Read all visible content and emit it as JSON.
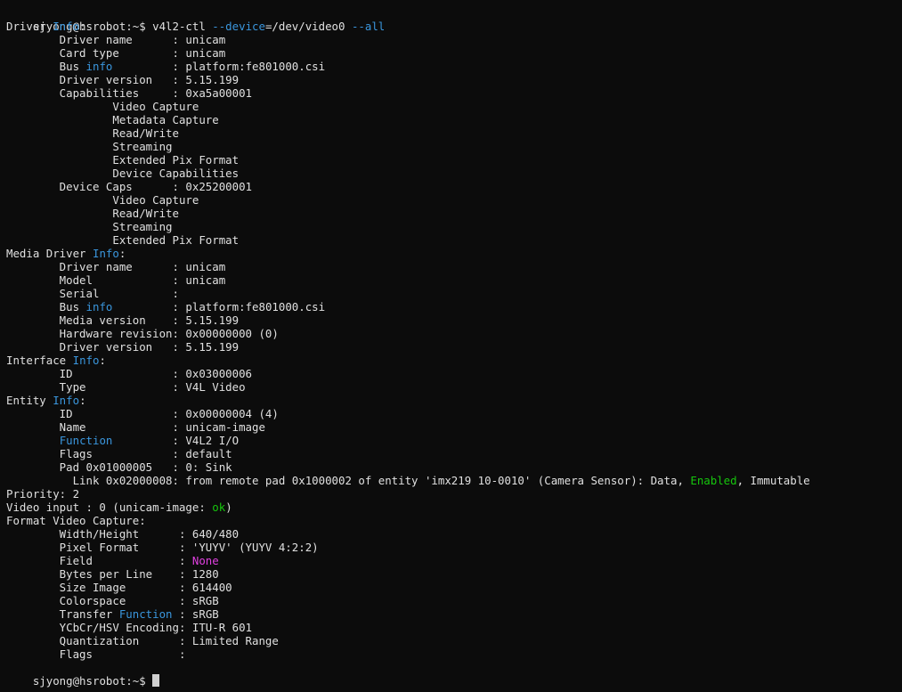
{
  "terminal": {
    "prompt": "sjyong@hsrobot:~$ ",
    "command_parts": [
      {
        "t": "v4l2-ctl "
      },
      {
        "t": "--device",
        "c": "cyan"
      },
      {
        "t": "=/dev/video0 "
      },
      {
        "t": "--all",
        "c": "cyan"
      }
    ],
    "lines": [
      [
        {
          "t": "Driver "
        },
        {
          "t": "Info",
          "c": "cyan"
        },
        {
          "t": ":"
        }
      ],
      [
        {
          "t": "        Driver name      : unicam"
        }
      ],
      [
        {
          "t": "        Card type        : unicam"
        }
      ],
      [
        {
          "t": "        Bus "
        },
        {
          "t": "info",
          "c": "cyan"
        },
        {
          "t": "         : platform:fe801000.csi"
        }
      ],
      [
        {
          "t": "        Driver version   : 5.15.199"
        }
      ],
      [
        {
          "t": "        Capabilities     : 0xa5a00001"
        }
      ],
      [
        {
          "t": "                Video Capture"
        }
      ],
      [
        {
          "t": "                Metadata Capture"
        }
      ],
      [
        {
          "t": "                Read/Write"
        }
      ],
      [
        {
          "t": "                Streaming"
        }
      ],
      [
        {
          "t": "                Extended Pix Format"
        }
      ],
      [
        {
          "t": "                Device Capabilities"
        }
      ],
      [
        {
          "t": "        Device Caps      : 0x25200001"
        }
      ],
      [
        {
          "t": "                Video Capture"
        }
      ],
      [
        {
          "t": "                Read/Write"
        }
      ],
      [
        {
          "t": "                Streaming"
        }
      ],
      [
        {
          "t": "                Extended Pix Format"
        }
      ],
      [
        {
          "t": "Media Driver "
        },
        {
          "t": "Info",
          "c": "cyan"
        },
        {
          "t": ":"
        }
      ],
      [
        {
          "t": "        Driver name      : unicam"
        }
      ],
      [
        {
          "t": "        Model            : unicam"
        }
      ],
      [
        {
          "t": "        Serial           :"
        }
      ],
      [
        {
          "t": "        Bus "
        },
        {
          "t": "info",
          "c": "cyan"
        },
        {
          "t": "         : platform:fe801000.csi"
        }
      ],
      [
        {
          "t": "        Media version    : 5.15.199"
        }
      ],
      [
        {
          "t": "        Hardware revision: 0x00000000 (0)"
        }
      ],
      [
        {
          "t": "        Driver version   : 5.15.199"
        }
      ],
      [
        {
          "t": "Interface "
        },
        {
          "t": "Info",
          "c": "cyan"
        },
        {
          "t": ":"
        }
      ],
      [
        {
          "t": "        ID               : 0x03000006"
        }
      ],
      [
        {
          "t": "        Type             : V4L Video"
        }
      ],
      [
        {
          "t": "Entity "
        },
        {
          "t": "Info",
          "c": "cyan"
        },
        {
          "t": ":"
        }
      ],
      [
        {
          "t": "        ID               : 0x00000004 (4)"
        }
      ],
      [
        {
          "t": "        Name             : unicam-image"
        }
      ],
      [
        {
          "t": "        "
        },
        {
          "t": "Function",
          "c": "cyan"
        },
        {
          "t": "         : V4L2 I/O"
        }
      ],
      [
        {
          "t": "        Flags            : default"
        }
      ],
      [
        {
          "t": "        Pad 0x01000005   : 0: Sink"
        }
      ],
      [
        {
          "t": "          Link 0x02000008: from remote pad 0x1000002 of entity 'imx219 10-0010' (Camera Sensor): Data, "
        },
        {
          "t": "Enabled",
          "c": "green"
        },
        {
          "t": ", Immutable"
        }
      ],
      [
        {
          "t": "Priority: 2"
        }
      ],
      [
        {
          "t": "Video input : 0 (unicam-image: "
        },
        {
          "t": "ok",
          "c": "green"
        },
        {
          "t": ")"
        }
      ],
      [
        {
          "t": "Format Video Capture:"
        }
      ],
      [
        {
          "t": "        Width/Height      : 640/480"
        }
      ],
      [
        {
          "t": "        Pixel Format      : 'YUYV' (YUYV 4:2:2)"
        }
      ],
      [
        {
          "t": "        Field             : "
        },
        {
          "t": "None",
          "c": "magenta"
        }
      ],
      [
        {
          "t": "        Bytes per Line    : 1280"
        }
      ],
      [
        {
          "t": "        Size Image        : 614400"
        }
      ],
      [
        {
          "t": "        Colorspace        : sRGB"
        }
      ],
      [
        {
          "t": "        Transfer "
        },
        {
          "t": "Function",
          "c": "cyan"
        },
        {
          "t": " : sRGB"
        }
      ],
      [
        {
          "t": "        YCbCr/HSV Encoding: ITU-R 601"
        }
      ],
      [
        {
          "t": "        Quantization      : Limited Range"
        }
      ],
      [
        {
          "t": "        Flags             :"
        }
      ]
    ]
  },
  "colors": {
    "background": "#0c0c0c",
    "text": "#e0e0e0",
    "cyan": "#3a96dd",
    "green": "#16c60c",
    "magenta": "#e040e0"
  }
}
